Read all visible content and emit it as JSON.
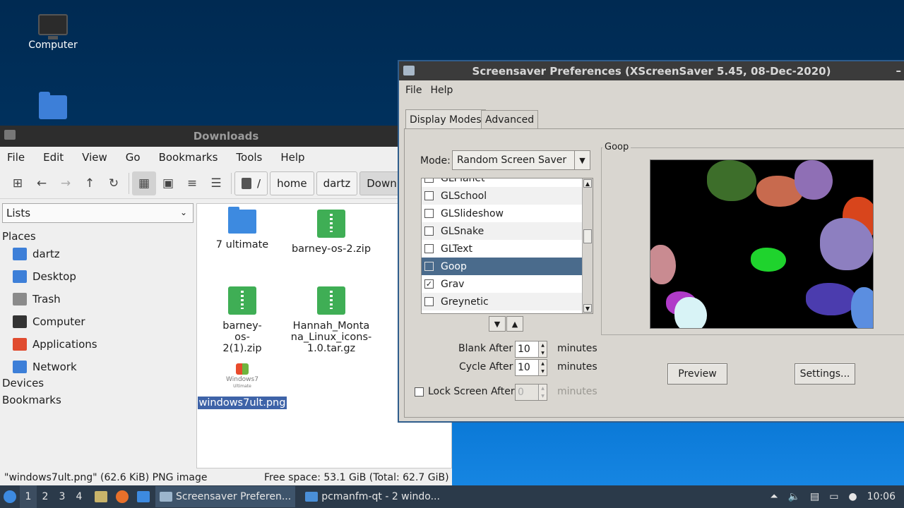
{
  "desktop": {
    "icons": [
      {
        "label": "Computer",
        "icon": "computer-icon"
      },
      {
        "label": "",
        "icon": "home-folder-icon"
      }
    ]
  },
  "filemanager": {
    "title": "Downloads",
    "menu": [
      "File",
      "Edit",
      "View",
      "Go",
      "Bookmarks",
      "Tools",
      "Help"
    ],
    "breadcrumbs": [
      "/",
      "home",
      "dartz",
      "Downlo"
    ],
    "side_combo": "Lists",
    "places_header": "Places",
    "places": [
      {
        "label": "dartz",
        "icon": "home-folder-icon",
        "color": "#3d7fd8"
      },
      {
        "label": "Desktop",
        "icon": "desktop-icon",
        "color": "#3d7fd8"
      },
      {
        "label": "Trash",
        "icon": "trash-icon",
        "color": "#8a8a8a"
      },
      {
        "label": "Computer",
        "icon": "computer-icon",
        "color": "#333333"
      },
      {
        "label": "Applications",
        "icon": "applications-icon",
        "color": "#e04b2f"
      },
      {
        "label": "Network",
        "icon": "network-icon",
        "color": "#3d7fd8"
      }
    ],
    "devices_header": "Devices",
    "bookmarks_header": "Bookmarks",
    "files": [
      {
        "name": "7 ultimate",
        "type": "folder"
      },
      {
        "name": "barney-os-2.zip",
        "type": "zip"
      },
      {
        "name": "barney-os-2(1).zip",
        "type": "zip"
      },
      {
        "name": "Hannah_Montana_Linux_icons-1.0.tar.gz",
        "type": "zip"
      },
      {
        "name": "windows7ult.png",
        "type": "image",
        "thumb_text": "Windows7",
        "thumb_sub": "Ultimate"
      }
    ],
    "status_left": "\"windows7ult.png\" (62.6 KiB) PNG image",
    "status_right": "Free space: 53.1 GiB (Total: 62.7 GiB)"
  },
  "screensaver": {
    "title": "Screensaver Preferences  (XScreenSaver 5.45, 08-Dec-2020)",
    "menu": [
      "File",
      "Help"
    ],
    "tabs": [
      "Display Modes",
      "Advanced"
    ],
    "mode_label": "Mode:",
    "mode_value": "Random Screen Saver",
    "list": [
      {
        "name": "GLPlanet",
        "checked": false,
        "selected": false
      },
      {
        "name": "GLSchool",
        "checked": false,
        "selected": false
      },
      {
        "name": "GLSlideshow",
        "checked": false,
        "selected": false
      },
      {
        "name": "GLSnake",
        "checked": false,
        "selected": false
      },
      {
        "name": "GLText",
        "checked": false,
        "selected": false
      },
      {
        "name": "Goop",
        "checked": false,
        "selected": true
      },
      {
        "name": "Grav",
        "checked": true,
        "selected": false
      },
      {
        "name": "Greynetic",
        "checked": false,
        "selected": false
      }
    ],
    "preview_group": "Goop",
    "blank_after_label": "Blank After",
    "blank_after_value": "10",
    "cycle_after_label": "Cycle After",
    "cycle_after_value": "10",
    "lock_label": "Lock Screen After",
    "lock_value": "0",
    "minutes": "minutes",
    "preview_button": "Preview",
    "settings_button": "Settings..."
  },
  "taskbar": {
    "workspaces": [
      "1",
      "2",
      "3",
      "4"
    ],
    "tasks": [
      "Screensaver Preferen...",
      "pcmanfm-qt - 2 windo..."
    ],
    "clock": "10:06"
  }
}
